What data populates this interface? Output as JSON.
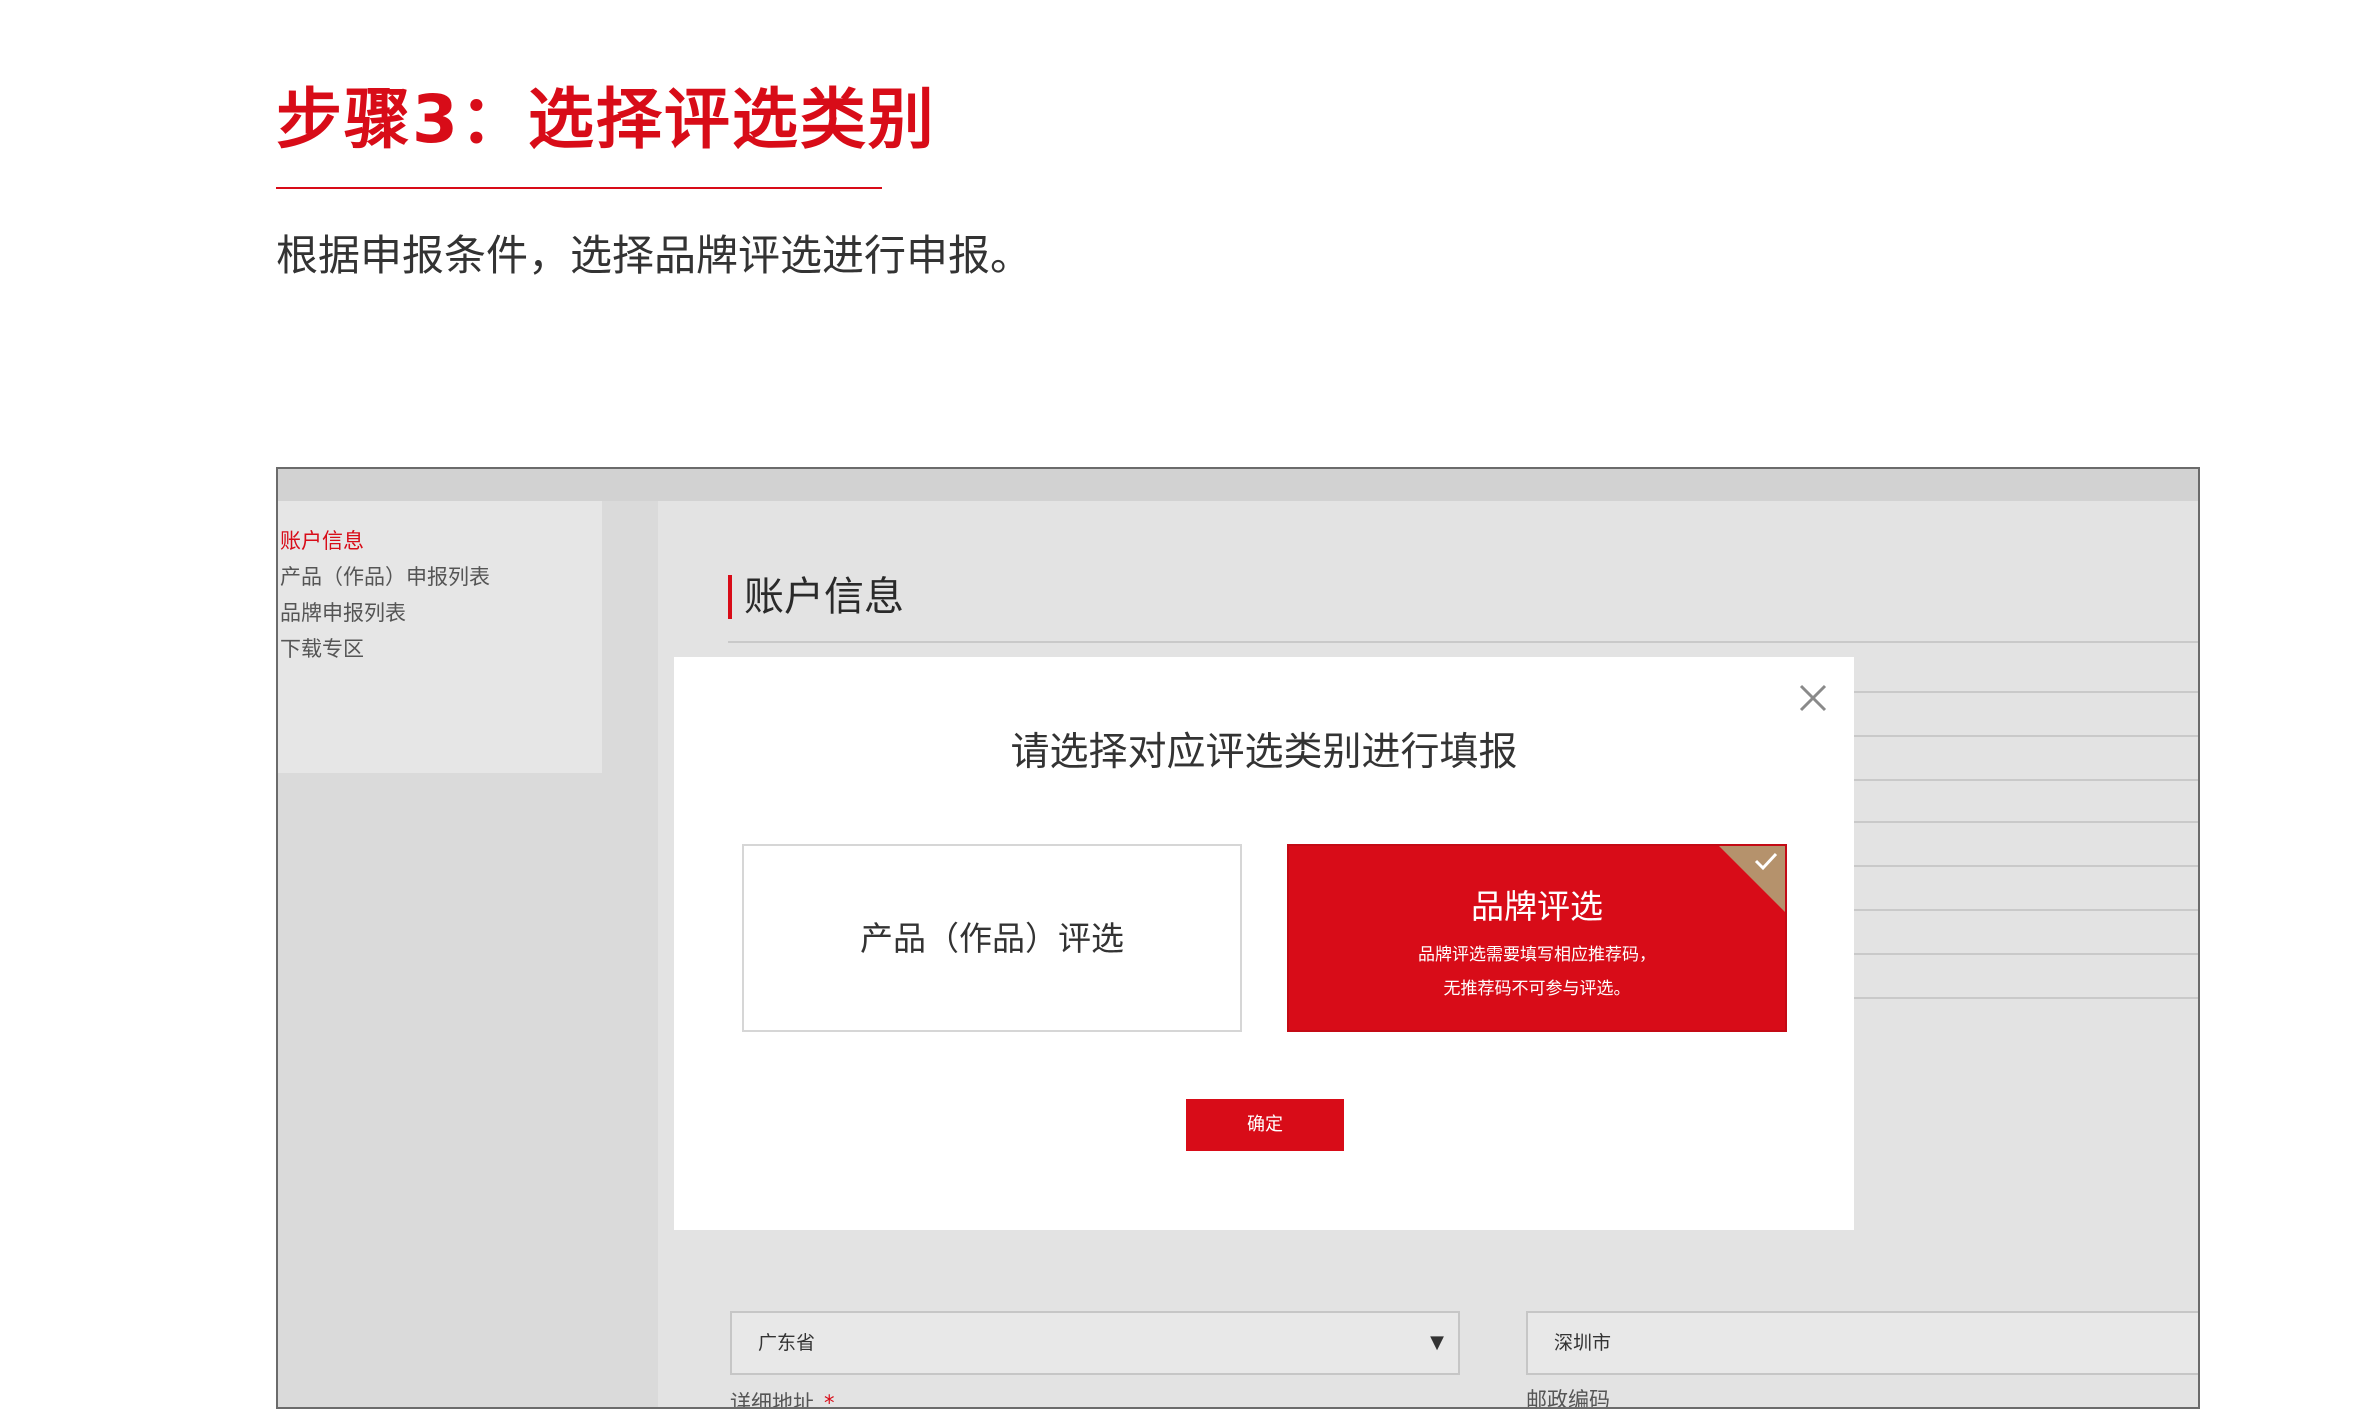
{
  "header": {
    "step_title": "步骤3：选择评选类别",
    "description": "根据申报条件，选择品牌评选进行申报。"
  },
  "sidebar": {
    "items": [
      {
        "label": "账户信息",
        "active": true
      },
      {
        "label": "产品（作品）申报列表",
        "active": false
      },
      {
        "label": "品牌申报列表",
        "active": false
      },
      {
        "label": "下载专区",
        "active": false
      }
    ]
  },
  "main": {
    "heading": "账户信息",
    "province_select": "广东省",
    "city_select": "深圳市",
    "address_label": "详细地址",
    "address_required_mark": "*",
    "postcode_label": "邮政编码"
  },
  "modal": {
    "title": "请选择对应评选类别进行填报",
    "option_product": "产品（作品）评选",
    "option_brand": "品牌评选",
    "brand_note_line1": "品牌评选需要填写相应推荐码，",
    "brand_note_line2": "无推荐码不可参与评选。",
    "selected": "品牌评选",
    "confirm_label": "确定",
    "close_icon": "close-icon",
    "check_icon": "check-icon"
  },
  "colors": {
    "accent": "#d80c18",
    "selected_corner": "#b5926c",
    "overlay_gray": "#dadada"
  }
}
